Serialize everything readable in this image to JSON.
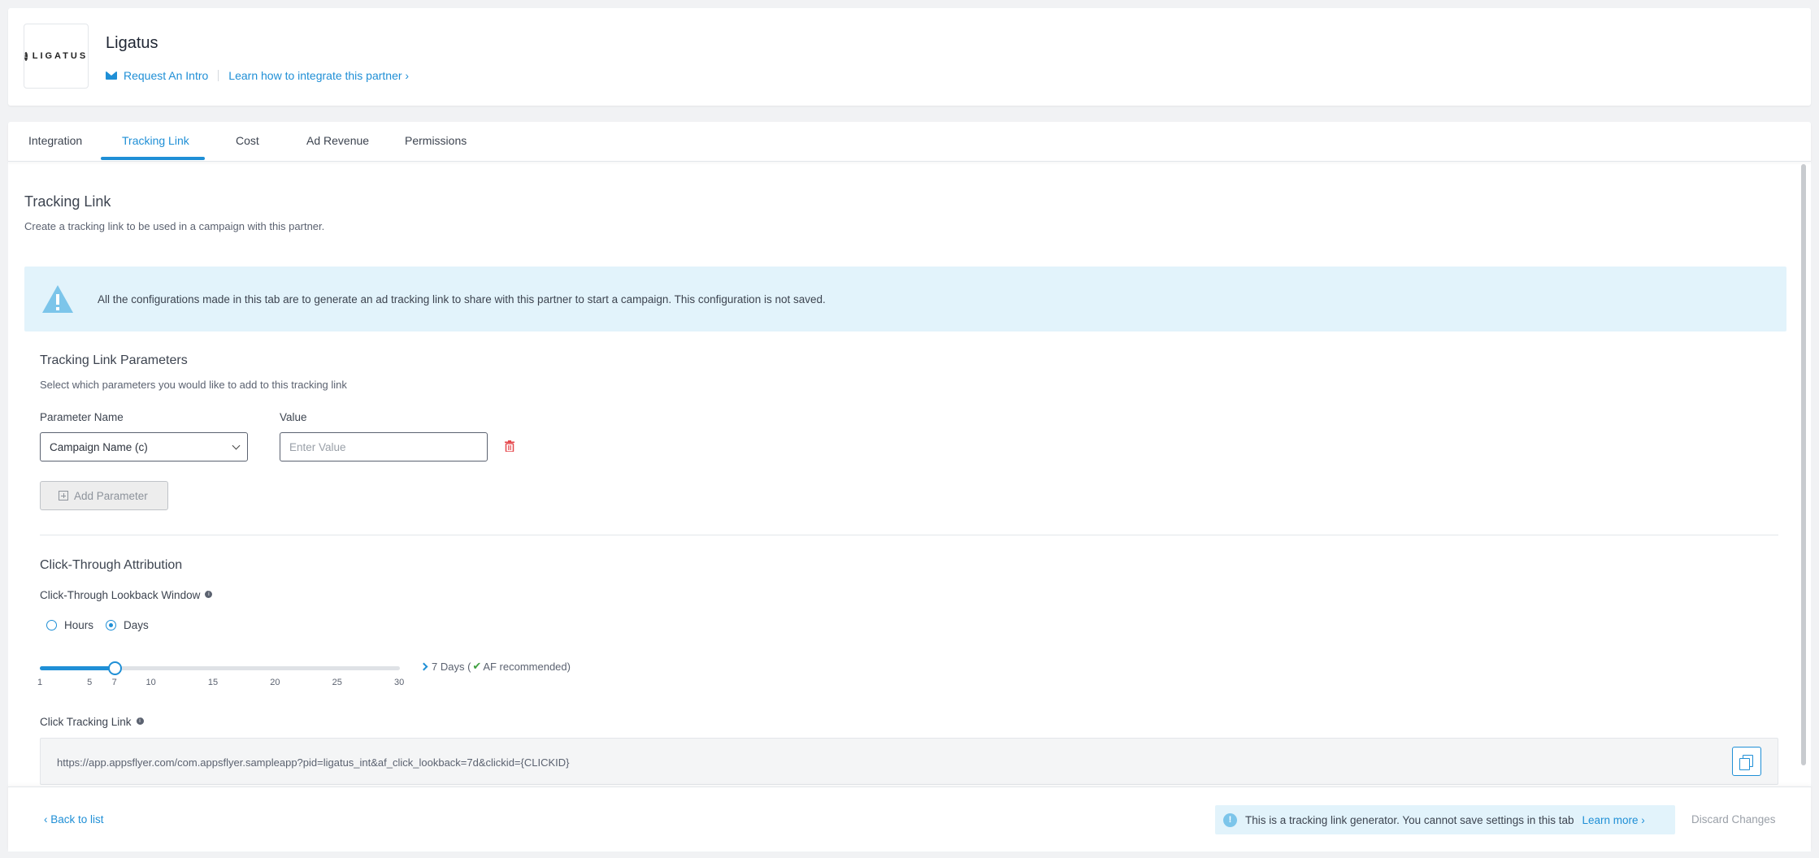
{
  "header": {
    "logo_text": "LIGATUS",
    "partner_name": "Ligatus",
    "request_intro": "Request An Intro",
    "learn_integrate": "Learn how to integrate this partner ›"
  },
  "tabs": [
    {
      "label": "Integration"
    },
    {
      "label": "Tracking Link"
    },
    {
      "label": "Cost"
    },
    {
      "label": "Ad Revenue"
    },
    {
      "label": "Permissions"
    }
  ],
  "active_tab": "Tracking Link",
  "tracking": {
    "title": "Tracking Link",
    "description": "Create a tracking link to be used in a campaign with this partner.",
    "alert": "All the configurations made in this tab are to generate an ad tracking link to share with this partner to start a campaign. This configuration is not saved."
  },
  "params": {
    "title": "Tracking Link Parameters",
    "description": "Select which parameters you would like to add to this tracking link",
    "name_label": "Parameter Name",
    "value_label": "Value",
    "selected_param": "Campaign Name (c)",
    "value_placeholder": "Enter Value",
    "add_button": "Add Parameter"
  },
  "attribution": {
    "title": "Click-Through Attribution",
    "window_label": "Click-Through Lookback Window",
    "radio_hours": "Hours",
    "radio_days": "Days",
    "selected_unit": "Days",
    "slider_value": 7,
    "slider_min": 1,
    "slider_max": 30,
    "ticks": [
      "1",
      "5",
      "7",
      "10",
      "15",
      "20",
      "25",
      "30"
    ],
    "rec_prefix": "7 Days (",
    "rec_suffix": "AF recommended)"
  },
  "click_link": {
    "label": "Click Tracking Link",
    "url": "https://app.appsflyer.com/com.appsflyer.sampleapp?pid=ligatus_int&af_click_lookback=7d&clickid={CLICKID}"
  },
  "footer": {
    "back": "‹ Back to list",
    "notice": "This is a tracking link generator. You cannot save settings in this tab",
    "learn_more": "Learn more ›",
    "discard": "Discard Changes"
  },
  "colors": {
    "accent": "#1f8fd6",
    "alert_bg": "#e2f3fb",
    "danger": "#e5484d",
    "success": "#3fa03f"
  }
}
